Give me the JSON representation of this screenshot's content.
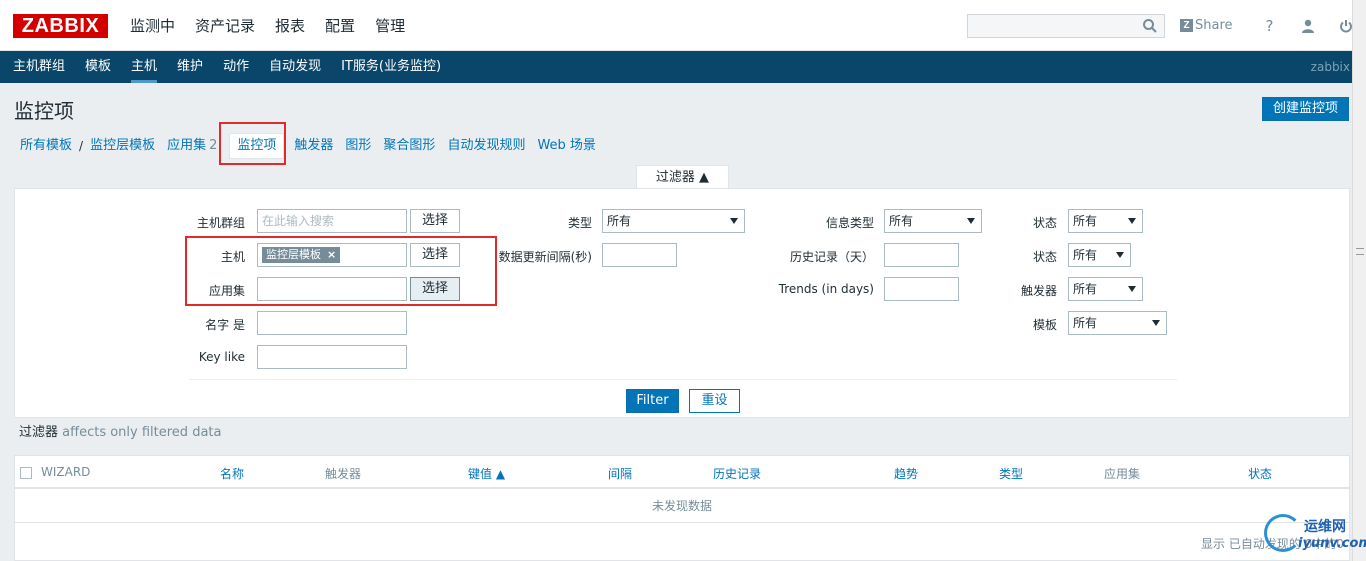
{
  "brand": {
    "logo": "ZABBIX"
  },
  "main_menu": [
    "监测中",
    "资产记录",
    "报表",
    "配置",
    "管理"
  ],
  "search": {
    "value": ""
  },
  "top_right": {
    "share": "Share",
    "help": "?"
  },
  "sub_menu": [
    "主机群组",
    "模板",
    "主机",
    "维护",
    "动作",
    "自动发现",
    "IT服务(业务监控)"
  ],
  "sub_right": "zabbix",
  "page": {
    "title": "监控项",
    "create_button": "创建监控项"
  },
  "breadcrumb": {
    "all_templates": "所有模板",
    "sep": "/",
    "template": "监控层模板",
    "apps": "应用集",
    "apps_count": "2",
    "items": "监控项",
    "triggers": "触发器",
    "graphs": "图形",
    "screens": "聚合图形",
    "discovery": "自动发现规则",
    "web": "Web 场景"
  },
  "filter": {
    "tab": "过滤器 ▲",
    "host_group_label": "主机群组",
    "host_group_placeholder": "在此输入搜索",
    "select": "选择",
    "host_label": "主机",
    "host_tag": "监控层模板",
    "host_tag_x": "×",
    "app_label": "应用集",
    "name_label": "名字 是",
    "key_label": "Key like",
    "type_label": "类型",
    "type_value": "所有",
    "interval_label": "数据更新间隔(秒)",
    "info_type_label": "信息类型",
    "info_type_value": "所有",
    "history_label": "历史记录（天）",
    "trends_label": "Trends (in days)",
    "state_label": "状态",
    "state_value": "所有",
    "status_label": "状态",
    "status_value": "所有",
    "triggers_label": "触发器",
    "triggers_value": "所有",
    "template_label": "模板",
    "template_value": "所有",
    "filter_button": "Filter",
    "reset_button": "重设",
    "note_title": "过滤器",
    "note_text": "affects only filtered data"
  },
  "table": {
    "columns": [
      "WIZARD",
      "名称",
      "触发器",
      "键值 ▲",
      "间隔",
      "历史记录",
      "趋势",
      "类型",
      "应用集",
      "状态"
    ],
    "empty": "未发现数据",
    "footer": "显示 已自动发现的 0中的0"
  },
  "watermark": {
    "line1": "运维网",
    "line2": "iyunv.com"
  }
}
